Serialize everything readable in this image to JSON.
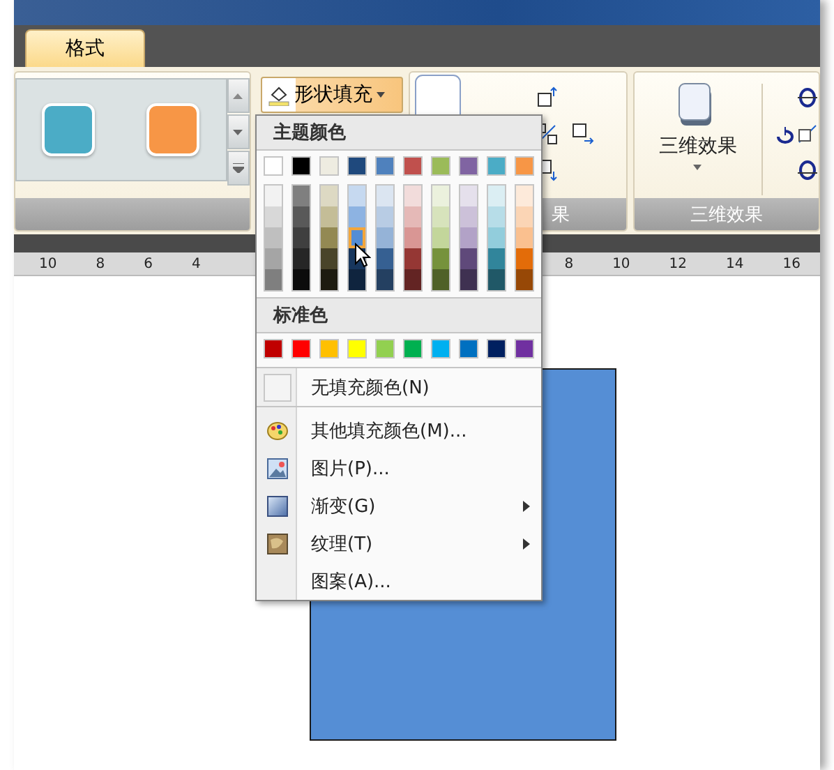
{
  "tabs": [
    {
      "label": "格式",
      "selected": true
    }
  ],
  "gallery": [
    {
      "color": "#4bacc6"
    },
    {
      "color": "#f79646"
    }
  ],
  "shape_fill_button": {
    "label": "形状填充"
  },
  "shadow_group": {
    "label": "果"
  },
  "three_d_group": {
    "button": "三维效果",
    "label": "三维效果"
  },
  "ruler": {
    "left_numbers": [
      "10",
      "8",
      "6",
      "4"
    ],
    "right_numbers": [
      "8",
      "10",
      "12",
      "14",
      "16"
    ]
  },
  "fill_menu": {
    "theme_heading": "主题颜色",
    "theme_colors": [
      {
        "color": "#ffffff",
        "shades": [
          {
            "color": "#f2f2f2",
            "selected": false
          },
          {
            "color": "#d8d8d8",
            "selected": false
          },
          {
            "color": "#bfbfbf",
            "selected": false
          },
          {
            "color": "#a5a5a5",
            "selected": false
          },
          {
            "color": "#7f7f7f",
            "selected": false
          }
        ]
      },
      {
        "color": "#000000",
        "shades": [
          {
            "color": "#7f7f7f",
            "selected": false
          },
          {
            "color": "#595959",
            "selected": false
          },
          {
            "color": "#3f3f3f",
            "selected": false
          },
          {
            "color": "#262626",
            "selected": false
          },
          {
            "color": "#0c0c0c",
            "selected": false
          }
        ]
      },
      {
        "color": "#eeece1",
        "shades": [
          {
            "color": "#ddd9c3",
            "selected": false
          },
          {
            "color": "#c4bd97",
            "selected": false
          },
          {
            "color": "#938953",
            "selected": false
          },
          {
            "color": "#494429",
            "selected": false
          },
          {
            "color": "#1d1b10",
            "selected": false
          }
        ]
      },
      {
        "color": "#1f497d",
        "shades": [
          {
            "color": "#c6d9f0",
            "selected": false
          },
          {
            "color": "#8db3e2",
            "selected": false
          },
          {
            "color": "#548dd4",
            "selected": true
          },
          {
            "color": "#17365d",
            "selected": false
          },
          {
            "color": "#0f243e",
            "selected": false
          }
        ]
      },
      {
        "color": "#4f81bd",
        "shades": [
          {
            "color": "#dbe5f1",
            "selected": false
          },
          {
            "color": "#b8cce4",
            "selected": false
          },
          {
            "color": "#95b3d7",
            "selected": false
          },
          {
            "color": "#366092",
            "selected": false
          },
          {
            "color": "#244061",
            "selected": false
          }
        ]
      },
      {
        "color": "#c0504d",
        "shades": [
          {
            "color": "#f2dcdb",
            "selected": false
          },
          {
            "color": "#e5b9b7",
            "selected": false
          },
          {
            "color": "#d99694",
            "selected": false
          },
          {
            "color": "#953734",
            "selected": false
          },
          {
            "color": "#632423",
            "selected": false
          }
        ]
      },
      {
        "color": "#9bbb59",
        "shades": [
          {
            "color": "#ebf1dd",
            "selected": false
          },
          {
            "color": "#d7e3bc",
            "selected": false
          },
          {
            "color": "#c3d69b",
            "selected": false
          },
          {
            "color": "#76923c",
            "selected": false
          },
          {
            "color": "#4f6128",
            "selected": false
          }
        ]
      },
      {
        "color": "#8064a2",
        "shades": [
          {
            "color": "#e5e0ec",
            "selected": false
          },
          {
            "color": "#ccc1d9",
            "selected": false
          },
          {
            "color": "#b2a2c7",
            "selected": false
          },
          {
            "color": "#5f497a",
            "selected": false
          },
          {
            "color": "#3f3151",
            "selected": false
          }
        ]
      },
      {
        "color": "#4bacc6",
        "shades": [
          {
            "color": "#dbeef3",
            "selected": false
          },
          {
            "color": "#b7dde8",
            "selected": false
          },
          {
            "color": "#92cddc",
            "selected": false
          },
          {
            "color": "#31859b",
            "selected": false
          },
          {
            "color": "#205867",
            "selected": false
          }
        ]
      },
      {
        "color": "#f79646",
        "shades": [
          {
            "color": "#fdeada",
            "selected": false
          },
          {
            "color": "#fbd5b5",
            "selected": false
          },
          {
            "color": "#fac08f",
            "selected": false
          },
          {
            "color": "#e36c09",
            "selected": false
          },
          {
            "color": "#974806",
            "selected": false
          }
        ]
      }
    ],
    "standard_heading": "标准色",
    "standard_colors": [
      {
        "color": "#c00000"
      },
      {
        "color": "#ff0000"
      },
      {
        "color": "#ffc000"
      },
      {
        "color": "#ffff00"
      },
      {
        "color": "#92d050"
      },
      {
        "color": "#00b050"
      },
      {
        "color": "#00b0f0"
      },
      {
        "color": "#0070c0"
      },
      {
        "color": "#002060"
      },
      {
        "color": "#7030a0"
      }
    ],
    "items": [
      {
        "kind": "none",
        "label": "无填充颜色(N)",
        "submenu": false
      },
      {
        "kind": "palette",
        "label": "其他填充颜色(M)...",
        "submenu": false
      },
      {
        "kind": "picture",
        "label": "图片(P)...",
        "submenu": false
      },
      {
        "kind": "gradient",
        "label": "渐变(G)",
        "submenu": true
      },
      {
        "kind": "texture",
        "label": "纹理(T)",
        "submenu": true
      },
      {
        "kind": "pattern",
        "label": "图案(A)...",
        "submenu": false
      }
    ]
  },
  "shape": {
    "color": "#558ed5"
  }
}
